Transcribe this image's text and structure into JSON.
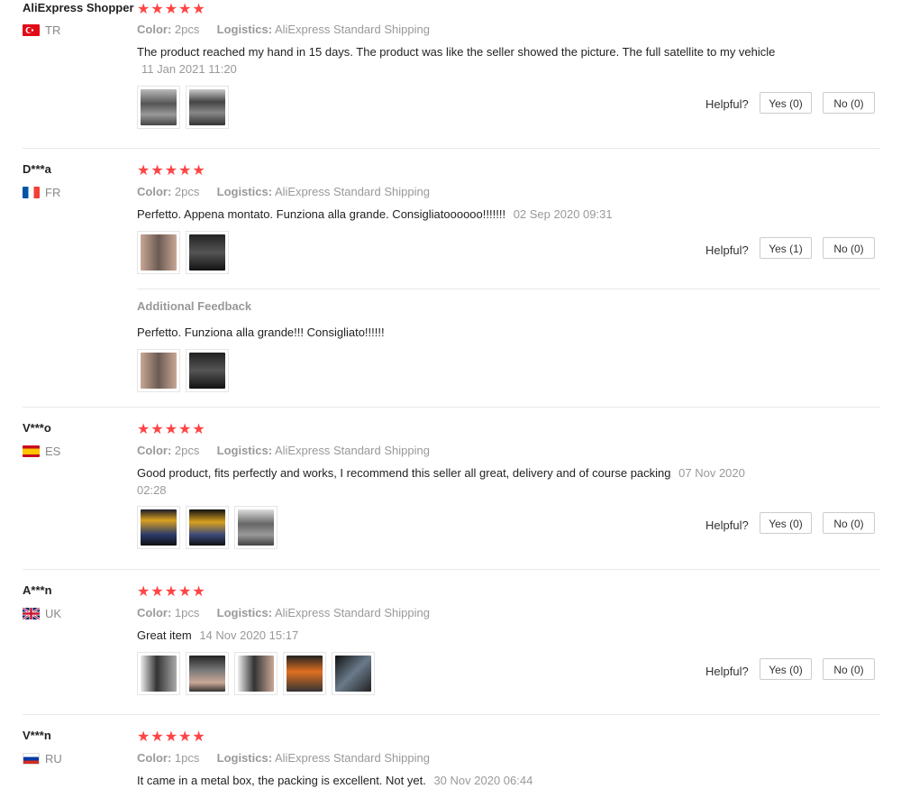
{
  "labels": {
    "color": "Color:",
    "logistics": "Logistics:",
    "helpful": "Helpful?",
    "additional_feedback": "Additional Feedback"
  },
  "stars_glyph": "★★★★★",
  "colors": {
    "star": "#ff4747",
    "muted": "#999999",
    "border": "#e8e8e8"
  },
  "reviews": [
    {
      "user": "AliExpress Shopper",
      "country": "TR",
      "color": "2pcs",
      "logistics": "AliExpress Standard Shipping",
      "text": "The product reached my hand in 15 days. The product was like the seller showed the picture. The full satellite to my vehicle",
      "date": "11 Jan 2021 11:20",
      "images": [
        "car-radio-photo",
        "car-radio-photo"
      ],
      "yes": "Yes (0)",
      "no": "No (0)"
    },
    {
      "user": "D***a",
      "country": "FR",
      "color": "2pcs",
      "logistics": "AliExpress Standard Shipping",
      "text": "Perfetto. Appena montato. Funziona alla grande. Consigliatoooooo!!!!!!!",
      "date": "02 Sep 2020 09:31",
      "images": [
        "packaged-item-photo",
        "car-dash-photo"
      ],
      "yes": "Yes (1)",
      "no": "No (0)",
      "additional": {
        "text": "Perfetto. Funziona alla grande!!! Consigliato!!!!!!",
        "images": [
          "packaged-item-photo",
          "car-dash-photo"
        ]
      }
    },
    {
      "user": "V***o",
      "country": "ES",
      "color": "2pcs",
      "logistics": "AliExpress Standard Shipping",
      "text": "Good product, fits perfectly and works, I recommend this seller all great, delivery and of course packing",
      "date": "07 Nov 2020 02:28",
      "images": [
        "item-on-table-photo",
        "item-on-table-photo",
        "car-radio-photo"
      ],
      "yes": "Yes (0)",
      "no": "No (0)"
    },
    {
      "user": "A***n",
      "country": "UK",
      "color": "1pcs",
      "logistics": "AliExpress Standard Shipping",
      "text": "Great item",
      "date": "14 Nov 2020 15:17",
      "images": [
        "hand-holding-item-photo",
        "car-dash-photo",
        "hand-holding-item-photo",
        "car-dash-lit-photo",
        "car-interior-photo"
      ],
      "yes": "Yes (0)",
      "no": "No (0)"
    },
    {
      "user": "V***n",
      "country": "RU",
      "color": "1pcs",
      "logistics": "AliExpress Standard Shipping",
      "text": "It came in a metal box, the packing is excellent. Not yet.",
      "date": "30 Nov 2020 06:44"
    }
  ]
}
